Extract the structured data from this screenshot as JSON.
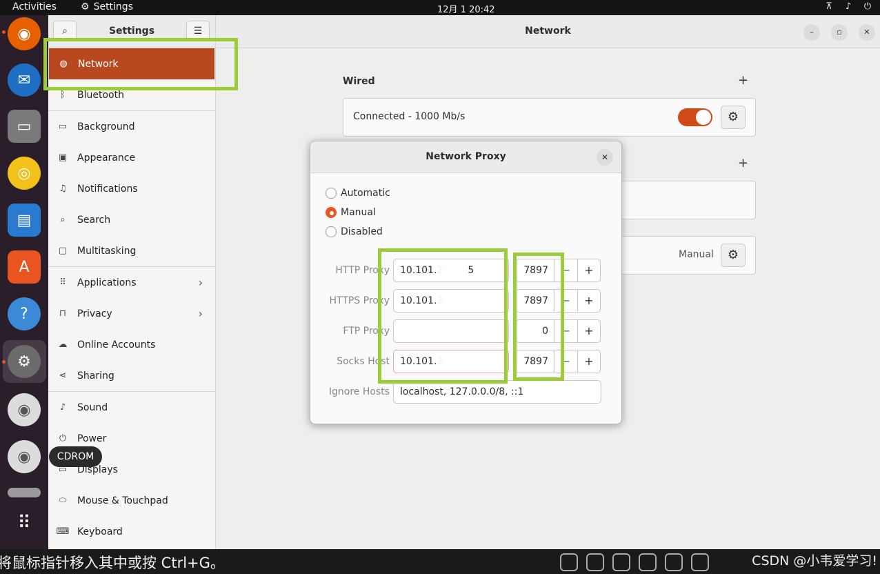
{
  "topbar": {
    "activities": "Activities",
    "app_name": "Settings",
    "clock": "12月 1  20:42"
  },
  "sidebar": {
    "title": "Settings",
    "items": [
      {
        "label": "Network",
        "icon": "globe-icon"
      },
      {
        "label": "Bluetooth",
        "icon": "bluetooth-icon"
      },
      {
        "label": "Background",
        "icon": "monitor-icon"
      },
      {
        "label": "Appearance",
        "icon": "appearance-icon"
      },
      {
        "label": "Notifications",
        "icon": "bell-icon"
      },
      {
        "label": "Search",
        "icon": "search-icon"
      },
      {
        "label": "Multitasking",
        "icon": "multitasking-icon"
      },
      {
        "label": "Applications",
        "icon": "grid-icon"
      },
      {
        "label": "Privacy",
        "icon": "lock-icon"
      },
      {
        "label": "Online Accounts",
        "icon": "cloud-icon"
      },
      {
        "label": "Sharing",
        "icon": "share-icon"
      },
      {
        "label": "Sound",
        "icon": "music-icon"
      },
      {
        "label": "Power",
        "icon": "power-icon"
      },
      {
        "label": "Displays",
        "icon": "display-icon"
      },
      {
        "label": "Mouse & Touchpad",
        "icon": "mouse-icon"
      },
      {
        "label": "Keyboard",
        "icon": "keyboard-icon"
      }
    ]
  },
  "main": {
    "title": "Network",
    "wired": {
      "title": "Wired",
      "status": "Connected - 1000 Mb/s",
      "enabled": true
    },
    "proxy_row": {
      "value": "Manual"
    }
  },
  "dialog": {
    "title": "Network Proxy",
    "modes": [
      {
        "label": "Automatic",
        "selected": false
      },
      {
        "label": "Manual",
        "selected": true
      },
      {
        "label": "Disabled",
        "selected": false
      }
    ],
    "rows": [
      {
        "label": "HTTP Proxy",
        "host": "10.101.2",
        "host_tail": "5",
        "port": "7897"
      },
      {
        "label": "HTTPS Proxy",
        "host": "10.101.2",
        "host_tail": "",
        "port": "7897"
      },
      {
        "label": "FTP Proxy",
        "host": "",
        "host_tail": "",
        "port": "0"
      },
      {
        "label": "Socks Host",
        "host": "10.101.2",
        "host_tail": "",
        "port": "7897"
      }
    ],
    "ignore": {
      "label": "Ignore Hosts",
      "value": "localhost, 127.0.0.0/8, ::1"
    }
  },
  "tooltip": "CDROM",
  "bottombar": {
    "message": "将鼠标指针移入其中或按 Ctrl+G。",
    "watermark": "CSDN @小韦爱学习!"
  },
  "colors": {
    "accent": "#e95420",
    "selected_bg": "#b8491f",
    "highlight": "#9ccc3c"
  }
}
